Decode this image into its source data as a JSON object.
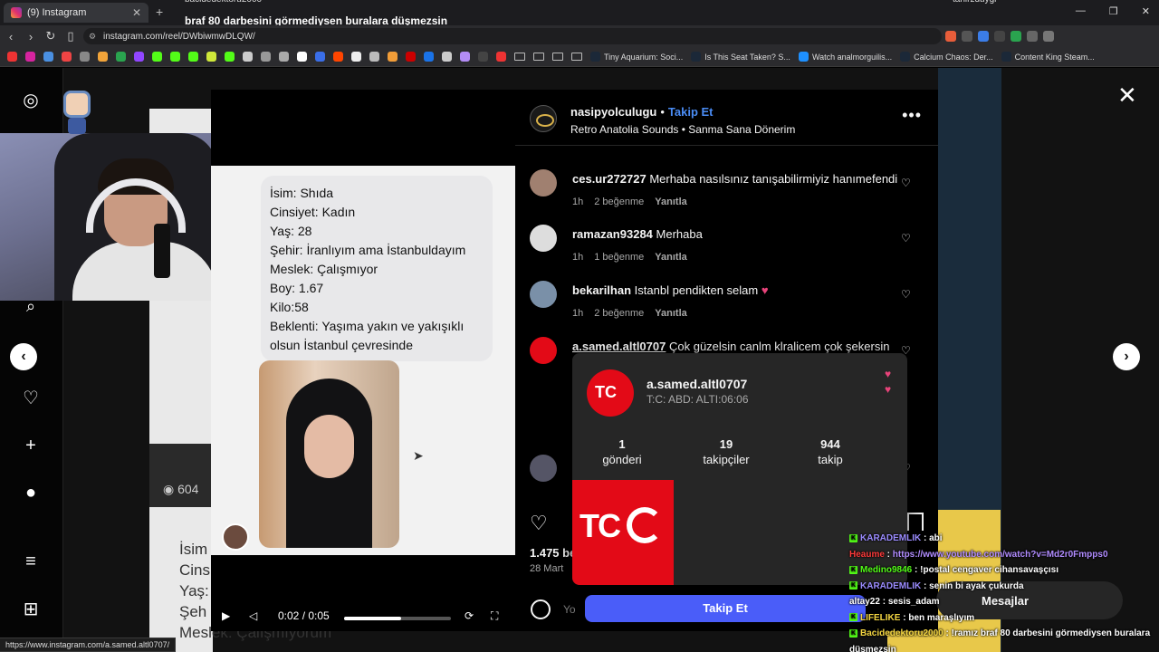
{
  "browser": {
    "tab_title": "(9) Instagram",
    "stream_title": "braf 80 darbesini görmediysen buralara düşmezsin",
    "stream_user": "bacidedektoru2000",
    "stream_user_right": "tahirzduygi",
    "url": "instagram.com/reel/DWbiwmwDLQW/",
    "status_url": "https://www.instagram.com/a.samed.altl0707/",
    "bookmarks": [
      "Tiny Aquarium: Soci...",
      "Is This Seat Taken? S...",
      "Watch analmorguilis...",
      "Calcium Chaos: Der...",
      "Content King Steam..."
    ]
  },
  "video": {
    "profile_lines": [
      "İsim: Shıda",
      "Cinsiyet: Kadın",
      "Yaş: 28",
      "Şehir: İranlıyım ama İstanbuldayım",
      "Meslek: Çalışmıyor",
      "Boy: 1.67",
      "Kilo:58",
      "Beklenti: Yaşıma yakın ve yakışıklı olsun İstanbul çevresinde"
    ],
    "time": "0:02 / 0:05",
    "progress": 0.53
  },
  "background": {
    "views": "604",
    "behind_lines": [
      "İsim",
      "Cins",
      "Yaş:",
      "Şeh",
      "Meslek: Çalışmıyorum"
    ]
  },
  "post": {
    "username": "nasipyolculugu",
    "follow": "Takip Et",
    "music": "Retro Anatolia Sounds • Sanma Sana Dönerim",
    "likes": "1.475 be",
    "date": "28 Mart",
    "comment_placeholder": "Yo"
  },
  "comments": [
    {
      "user": "ces.ur272727",
      "text": "Merhaba nasılsınız tanışabilirmiyiz hanımefendi",
      "time": "1h",
      "likes": "2 beğenme",
      "reply": "Yanıtla"
    },
    {
      "user": "ramazan93284",
      "text": "Merhaba",
      "time": "1h",
      "likes": "1 beğenme",
      "reply": "Yanıtla"
    },
    {
      "user": "bekarilhan",
      "text": "Istanbl pendikten selam",
      "time": "1h",
      "likes": "2 beğenme",
      "reply": "Yanıtla"
    },
    {
      "user": "a.samed.altl0707",
      "text": "Çok güzelsin canlm klralicem çok şekersin",
      "time": "",
      "likes": "",
      "reply": ""
    }
  ],
  "hover_card": {
    "avatar_text": "TC",
    "name": "a.samed.altl0707",
    "bio": "T:C: ABD: ALTI:06:06",
    "stats": [
      {
        "value": "1",
        "label": "gönderi"
      },
      {
        "value": "19",
        "label": "takipçiler"
      },
      {
        "value": "944",
        "label": "takip"
      }
    ],
    "post_text": "TC",
    "follow_button": "Takip Et"
  },
  "messages_label": "Mesajlar",
  "chat": [
    {
      "user": "KARADEMLIK",
      "text": "abi",
      "color": "#9b8cff",
      "badge": true
    },
    {
      "user": "Heaume",
      "text": "https://www.youtube.com/watch?v=Md2r0Fmpps0",
      "color": "#ff3b3b",
      "badge": false,
      "text_color": "#b18cff"
    },
    {
      "user": "Medino9846",
      "text": "!postal cengaver cihansavaşçısı",
      "color": "#53fc18",
      "badge": true
    },
    {
      "user": "KARADEMLIK",
      "text": "senin bi ayak çukurda",
      "color": "#9b8cff",
      "badge": true
    },
    {
      "user": "altay22",
      "text": "sesis_adam",
      "color": "#ffffff",
      "badge": false
    },
    {
      "user": "LIFELIKE",
      "text": "ben maraşlıyım",
      "color": "#f5d742",
      "badge": true
    },
    {
      "user": "Bacidedektoru2000",
      "text": "!ramız braf 80 darbesini görmediysen buralara düşmezsin",
      "color": "#f5d742",
      "badge": true
    }
  ]
}
